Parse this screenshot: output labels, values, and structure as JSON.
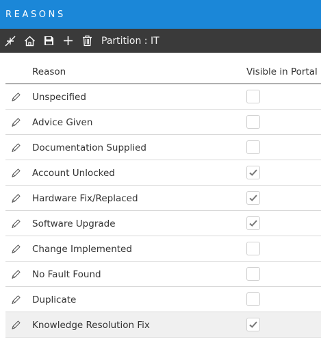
{
  "app": {
    "title": "REASONS"
  },
  "toolbar": {
    "buttons": [
      {
        "name": "collapse",
        "icon": "collapse-icon"
      },
      {
        "name": "home",
        "icon": "home-icon"
      },
      {
        "name": "save",
        "icon": "save-icon"
      },
      {
        "name": "add",
        "icon": "plus-icon"
      },
      {
        "name": "delete",
        "icon": "trash-icon"
      }
    ],
    "partition_label": "Partition : IT"
  },
  "grid": {
    "columns": {
      "reason": "Reason",
      "visible": "Visible in Portal"
    },
    "rows": [
      {
        "reason": "Unspecified",
        "visible": false
      },
      {
        "reason": "Advice Given",
        "visible": false
      },
      {
        "reason": "Documentation Supplied",
        "visible": false
      },
      {
        "reason": "Account Unlocked",
        "visible": true
      },
      {
        "reason": "Hardware Fix/Replaced",
        "visible": true
      },
      {
        "reason": "Software Upgrade",
        "visible": true
      },
      {
        "reason": "Change Implemented",
        "visible": false
      },
      {
        "reason": "No Fault Found",
        "visible": false
      },
      {
        "reason": "Duplicate",
        "visible": false
      },
      {
        "reason": "Knowledge Resolution Fix",
        "visible": true,
        "selected": true
      }
    ]
  },
  "colors": {
    "titlebar": "#1b87d8",
    "toolbar": "#3a3a3a",
    "check": "#777777"
  }
}
